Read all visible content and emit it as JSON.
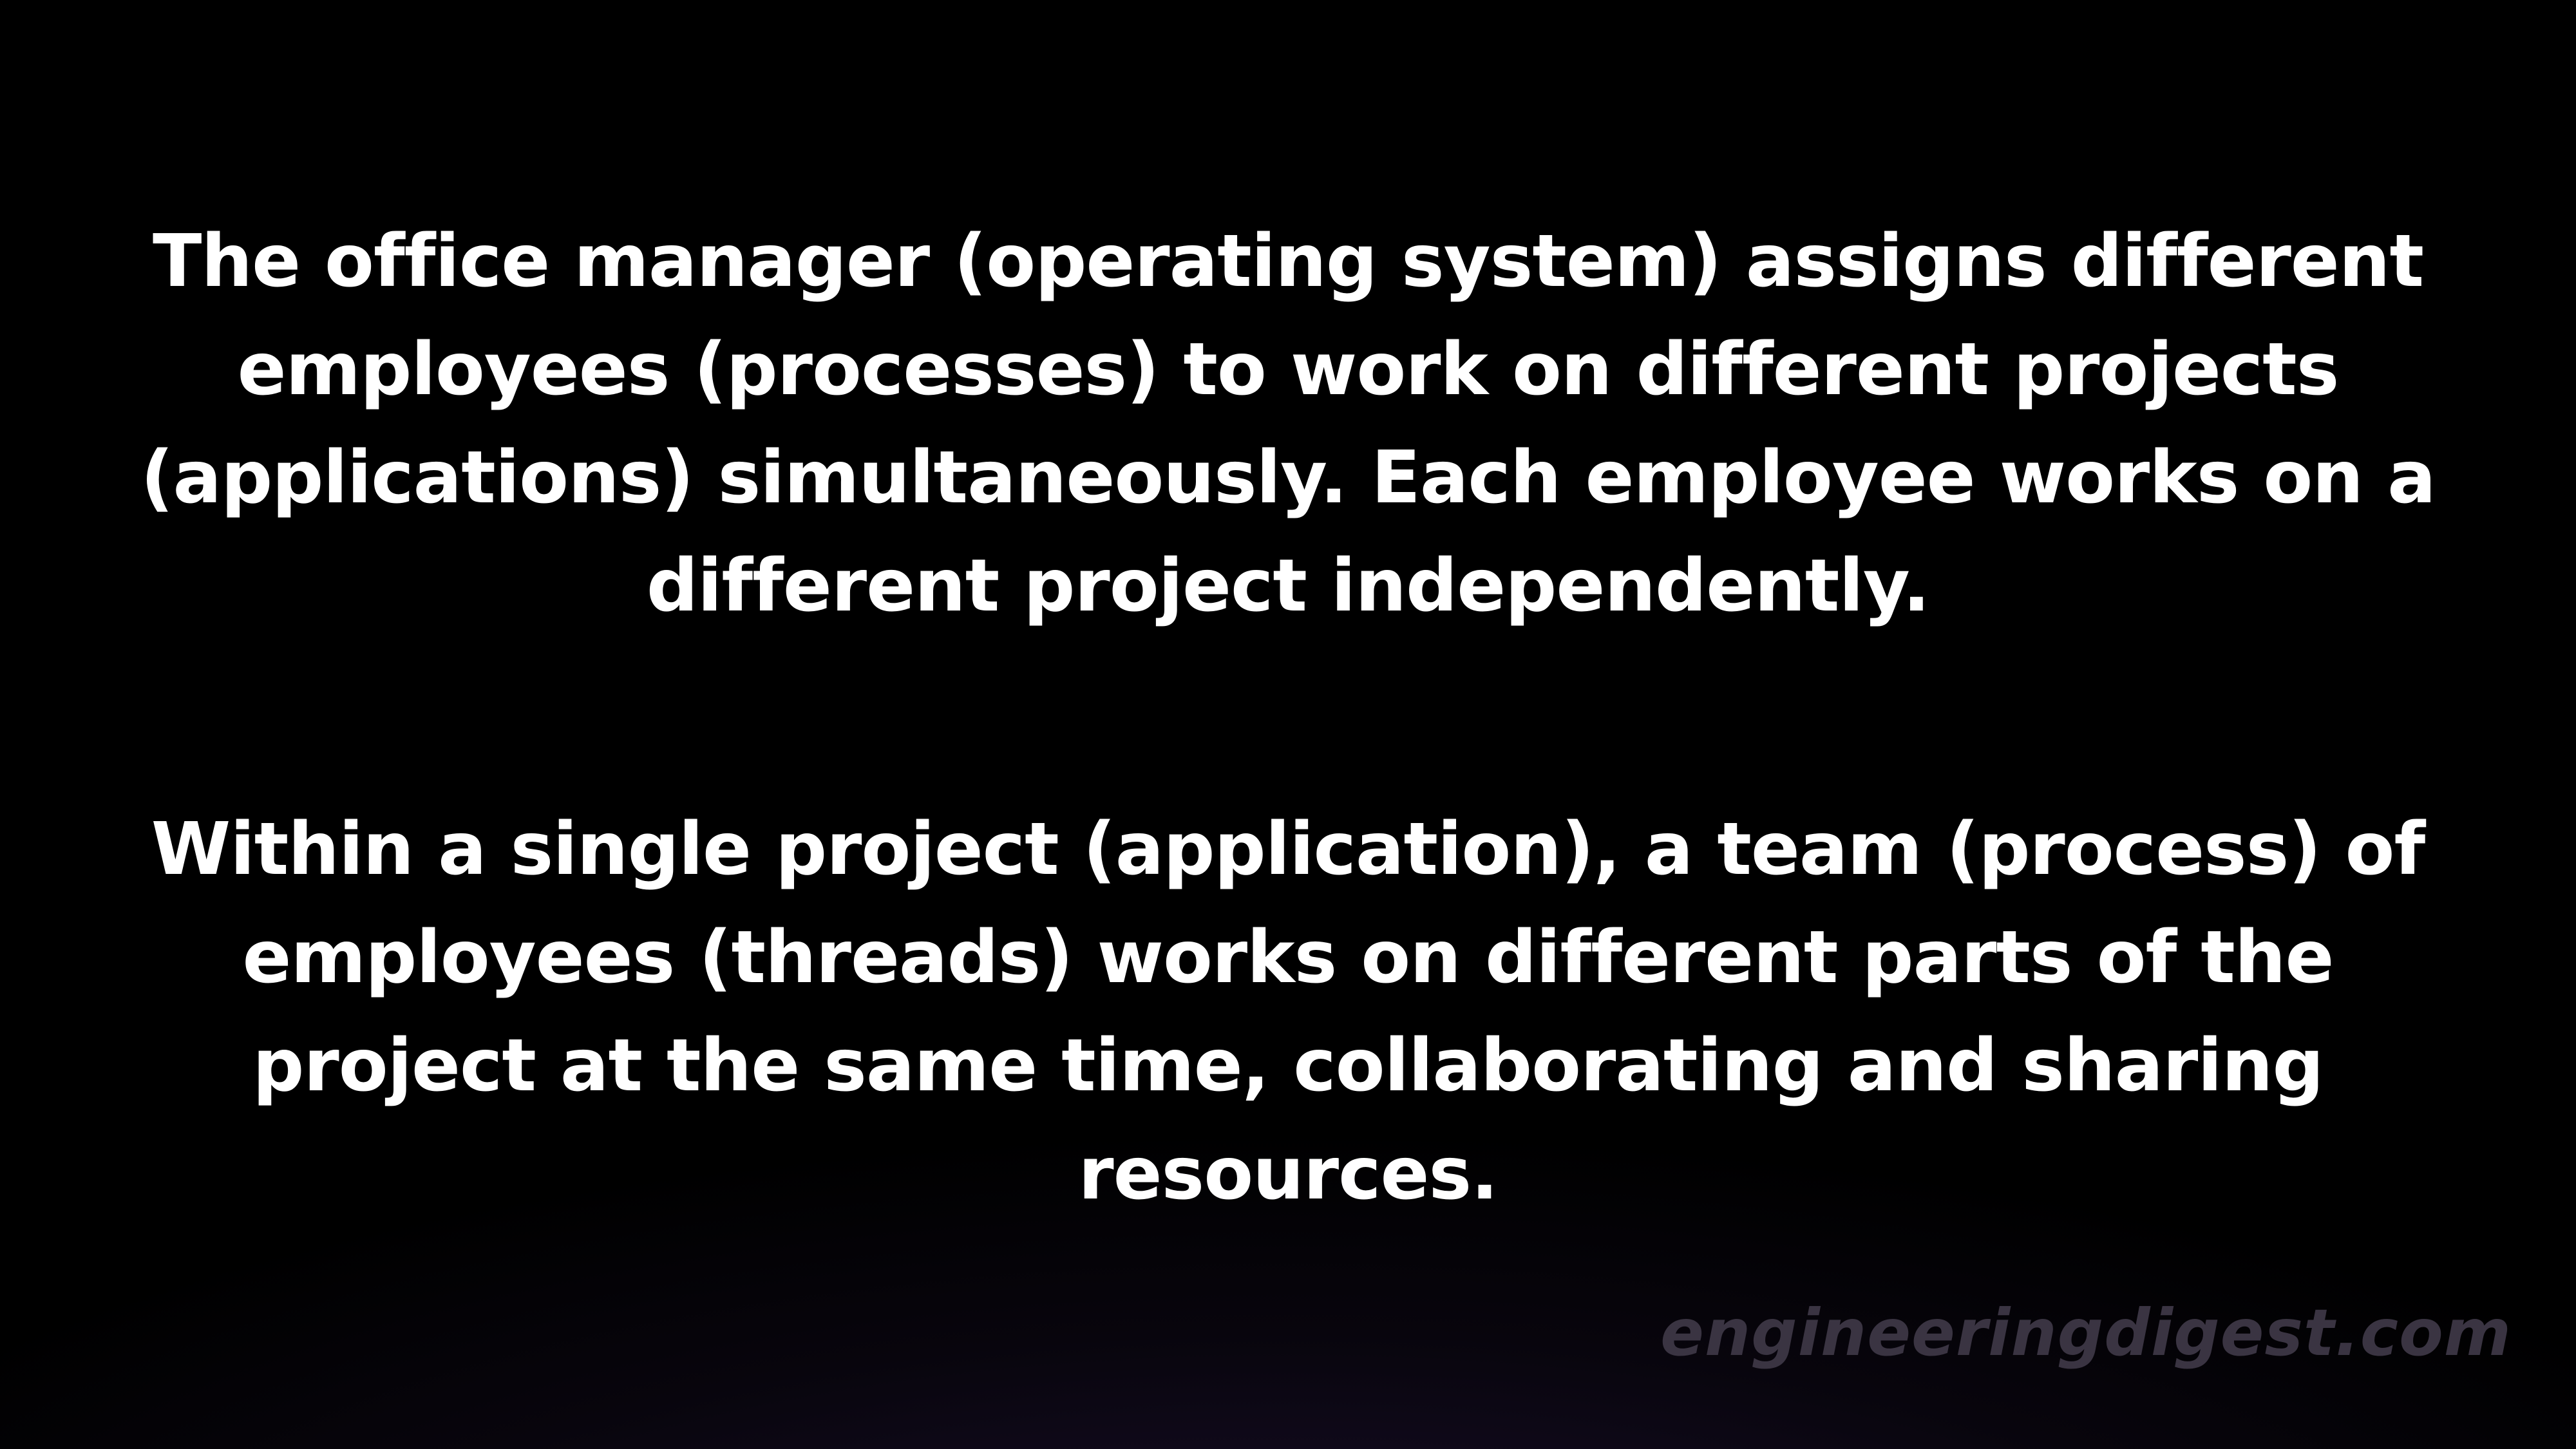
{
  "paragraphs": {
    "first": "The office manager (operating system) assigns different employees (processes) to work on different projects (applications) simultaneously. Each employee works on a different project independently.",
    "second": "Within a single project (application), a team (process) of employees (threads) works on different parts of the project at the same time, collaborating and sharing resources."
  },
  "watermark": {
    "text": "engineeringdigest.com"
  },
  "colors": {
    "background": "#000000",
    "text": "#ffffff",
    "watermark": "#3a3442",
    "glow": "#1d1230"
  }
}
